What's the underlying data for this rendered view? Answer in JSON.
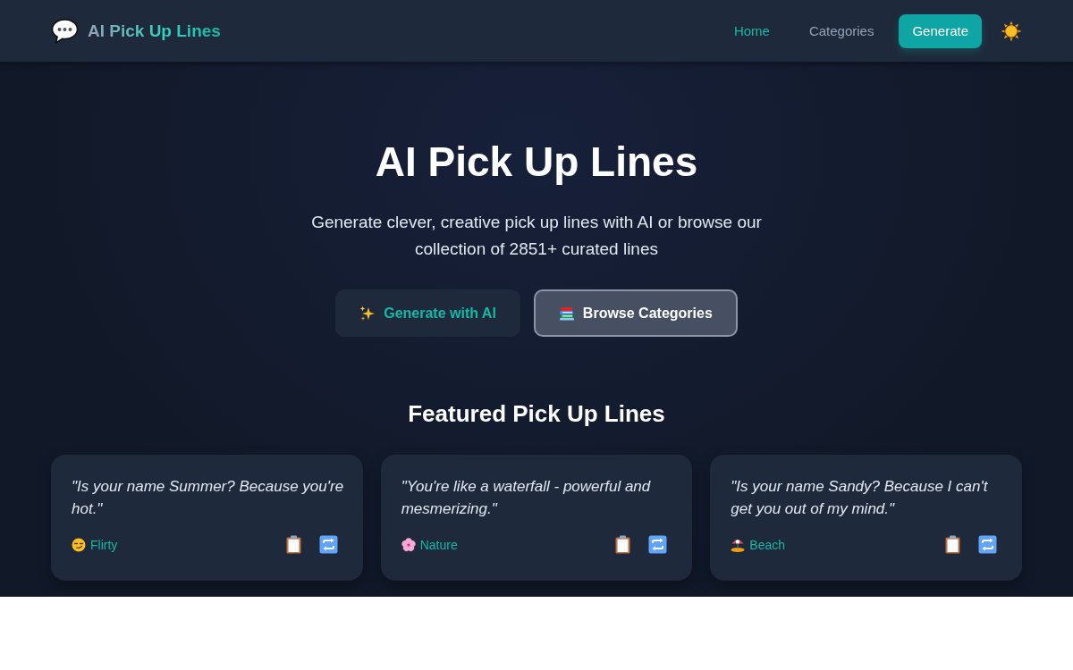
{
  "header": {
    "logo_text": "AI Pick Up Lines",
    "nav": [
      {
        "label": "Home",
        "selected": true
      },
      {
        "label": "Categories",
        "selected": false
      }
    ],
    "generate_button": "Generate"
  },
  "hero": {
    "title": "AI Pick Up Lines",
    "subtitle": "Generate clever, creative pick up lines with AI or browse our collection of 2851+ curated lines",
    "buttons": [
      {
        "label": "Generate with AI",
        "kind": "secondary"
      },
      {
        "label": "Browse Categories",
        "kind": "outlined"
      }
    ]
  },
  "featured": {
    "title": "Featured Pick Up Lines",
    "cards": [
      {
        "quote": "\"Is your name Summer? Because you're hot.\"",
        "category": "Flirty",
        "kind": "smirk"
      },
      {
        "quote": "\"You're like a waterfall - powerful and mesmerizing.\"",
        "category": "Nature",
        "kind": "flower"
      },
      {
        "quote": "\"Is your name Sandy? Because I can't get you out of my mind.\"",
        "category": "Beach",
        "kind": "beach"
      }
    ]
  }
}
